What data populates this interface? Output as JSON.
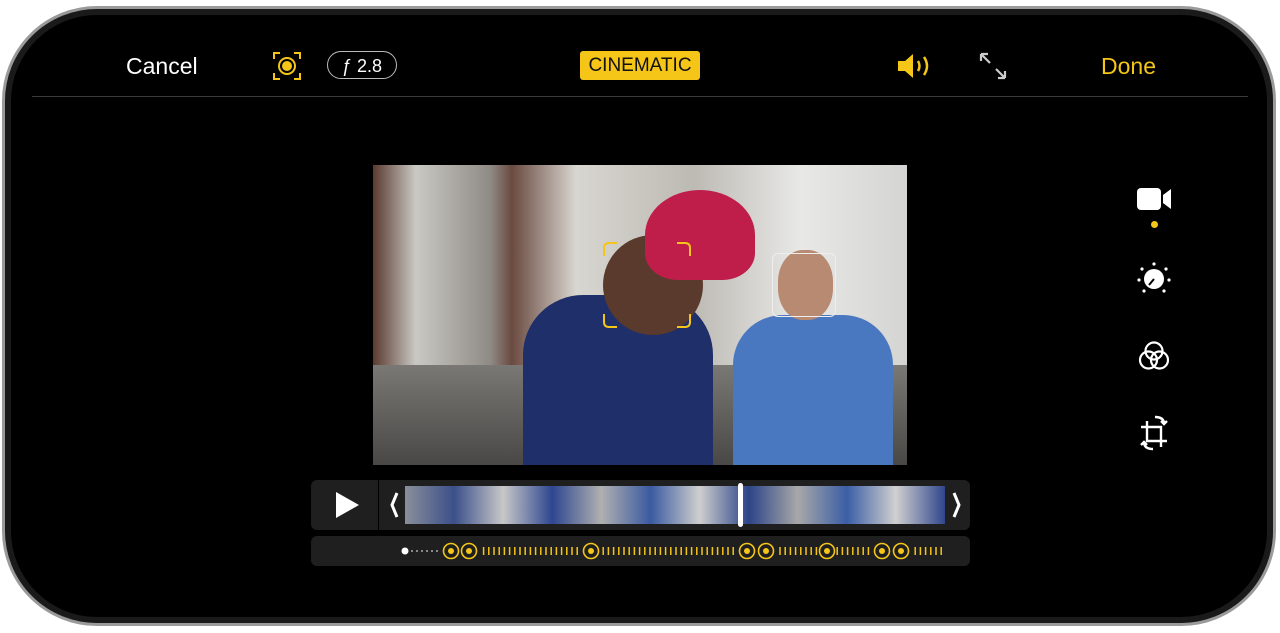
{
  "header": {
    "cancel_label": "Cancel",
    "aperture_label": "ƒ 2.8",
    "mode_badge": "CINEMATIC",
    "done_label": "Done"
  },
  "icons": {
    "focus_lock": "focus-lock-icon",
    "volume": "speaker-icon",
    "fullscreen": "expand-icon",
    "play": "play-icon"
  },
  "sidebar": {
    "items": [
      {
        "name": "video",
        "selected": true
      },
      {
        "name": "adjust"
      },
      {
        "name": "filters"
      },
      {
        "name": "crop"
      }
    ]
  },
  "colors": {
    "accent": "#f5c518",
    "background": "#000000",
    "panel": "#1f1f1f"
  },
  "timeline": {
    "playhead_fraction": 0.62,
    "focus_points": 8
  }
}
